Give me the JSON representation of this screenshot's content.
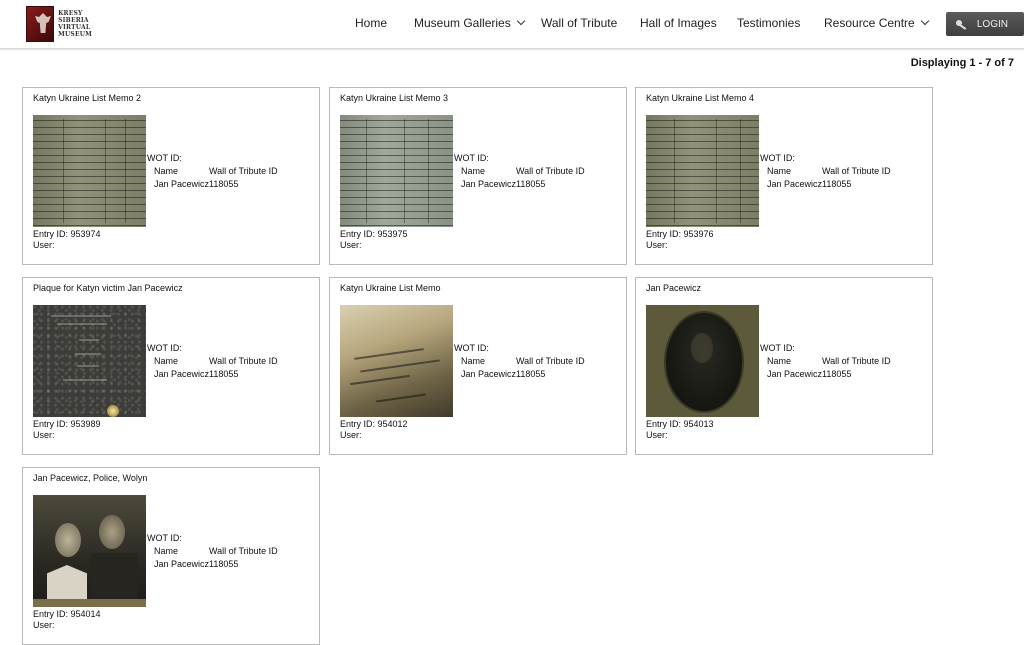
{
  "header": {
    "logo_text": [
      "KRESY",
      "SIBERIA",
      "VIRTUAL",
      "MUSEUM"
    ],
    "nav": [
      {
        "label": "Home",
        "dropdown": false
      },
      {
        "label": "Museum Galleries",
        "dropdown": true
      },
      {
        "label": "Wall of Tribute",
        "dropdown": false
      },
      {
        "label": "Hall of Images",
        "dropdown": false
      },
      {
        "label": "Testimonies",
        "dropdown": false
      },
      {
        "label": "Resource Centre",
        "dropdown": true
      }
    ],
    "login_label": "LOGIN"
  },
  "display_count": "Displaying 1 - 7 of 7",
  "labels": {
    "wot_id": "WOT ID:",
    "name_header": "Name",
    "wot_header": "Wall of Tribute ID",
    "user": "User:"
  },
  "cards": [
    {
      "title": "Katyn Ukraine List Memo 2",
      "thumb": "document-list-image",
      "name": "Jan Pacewicz",
      "wot_id": "118055",
      "entry_id": "Entry ID: 953974"
    },
    {
      "title": "Katyn Ukraine List Memo 3",
      "thumb": "document-list-image",
      "name": "Jan Pacewicz",
      "wot_id": "118055",
      "entry_id": "Entry ID: 953975"
    },
    {
      "title": "Katyn Ukraine List Memo 4",
      "thumb": "document-list-image",
      "name": "Jan Pacewicz",
      "wot_id": "118055",
      "entry_id": "Entry ID: 953976"
    },
    {
      "title": "Plaque for Katyn victim Jan Pacewicz",
      "thumb": "plaque-image",
      "name": "Jan Pacewicz",
      "wot_id": "118055",
      "entry_id": "Entry ID: 953989"
    },
    {
      "title": "Katyn Ukraine List Memo",
      "thumb": "memo-photo-image",
      "name": "Jan Pacewicz",
      "wot_id": "118055",
      "entry_id": "Entry ID: 954012"
    },
    {
      "title": "Jan Pacewicz",
      "thumb": "portrait-image",
      "name": "Jan Pacewicz",
      "wot_id": "118055",
      "entry_id": "Entry ID: 954013"
    },
    {
      "title": "Jan Pacewicz, Police, Wolyn",
      "thumb": "two-men-photo-image",
      "name": "Jan Pacewicz",
      "wot_id": "118055",
      "entry_id": "Entry ID: 954014"
    }
  ]
}
